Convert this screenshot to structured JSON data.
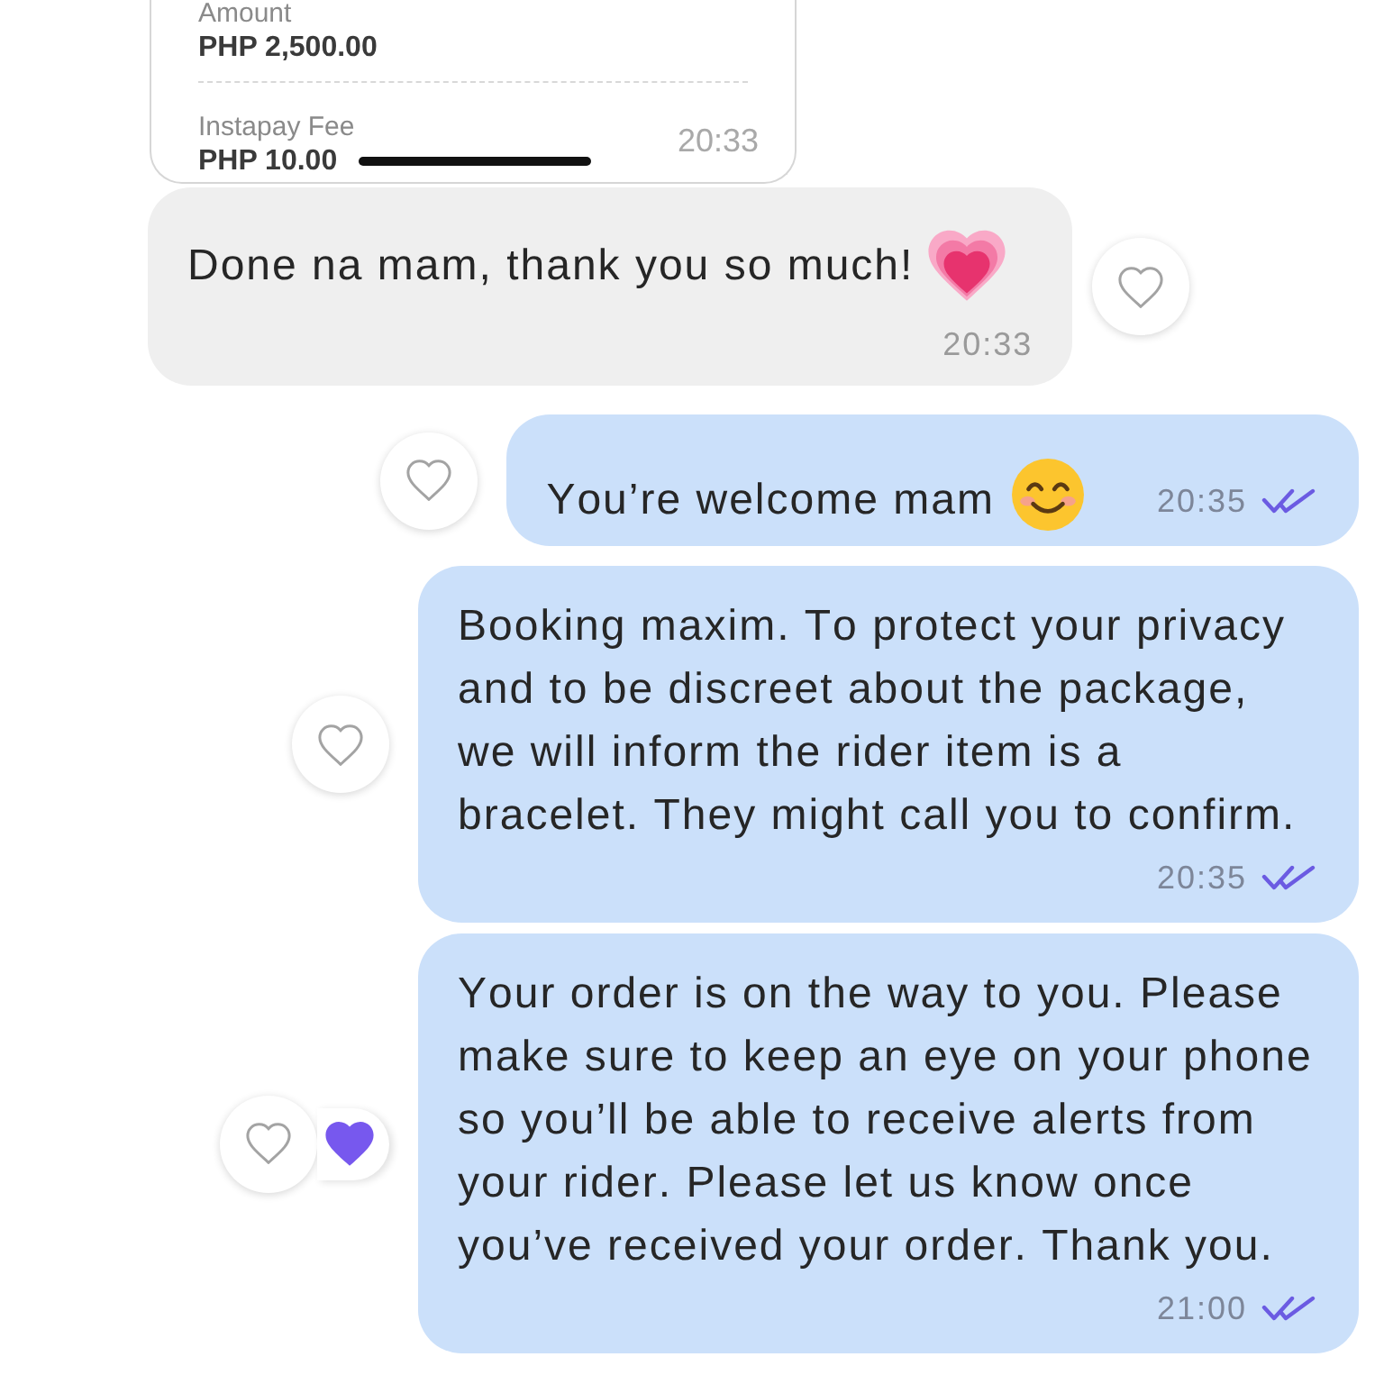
{
  "attachment": {
    "fields": [
      {
        "label": "Amount",
        "value": "PHP 2,500.00"
      },
      {
        "label": "Instapay Fee",
        "value": "PHP 10.00"
      }
    ],
    "time": "20:33"
  },
  "messages": [
    {
      "kind": "received",
      "content": [
        {
          "kind": "text",
          "text": "Done na mam, thank you so much!"
        },
        {
          "kind": "heart"
        }
      ],
      "time": "20:33",
      "reacted": false
    },
    {
      "kind": "sent",
      "content": [
        {
          "kind": "text",
          "text": "You’re welcome mam"
        },
        {
          "kind": "smiley"
        }
      ],
      "time": "20:35",
      "read": true,
      "reacted": false
    },
    {
      "kind": "sent",
      "content": [
        {
          "kind": "text",
          "text": "Booking maxim. To protect your privacy and to be discreet about the package, we will inform the rider item is a bracelet. They might call you to confirm."
        }
      ],
      "time": "20:35",
      "read": true,
      "reacted": false
    },
    {
      "kind": "sent",
      "content": [
        {
          "kind": "text",
          "text": "Your order is on the way to you. Please make sure to keep an eye on your phone so you’ll be able to receive alerts from your rider. Please let us know once you’ve received your order. Thank you."
        }
      ],
      "time": "21:00",
      "read": true,
      "reacted": true
    }
  ]
}
